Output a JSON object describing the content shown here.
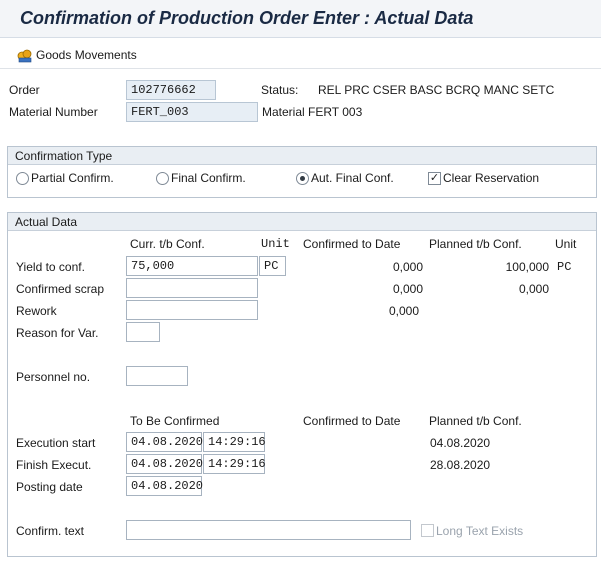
{
  "title": "Confirmation of Production Order Enter : Actual Data",
  "toolbar": {
    "goods_movements": "Goods Movements",
    "goods_icon": "goods-movements-icon"
  },
  "header": {
    "order_label": "Order",
    "order_value": "102776662",
    "status_label": "Status:",
    "status_value": "REL  PRC  CSER BASC BCRQ MANC SETC",
    "material_label": "Material Number",
    "material_value": "FERT_003",
    "material_desc": "Material FERT 003"
  },
  "confirmation_type": {
    "title": "Confirmation Type",
    "partial": "Partial Confirm.",
    "final": "Final Confirm.",
    "auto_final": "Aut. Final Conf.",
    "clear_reservation": "Clear Reservation",
    "selected": "auto_final",
    "clear_reservation_checked": true
  },
  "actual_data": {
    "title": "Actual Data",
    "col_curr": "Curr. t/b Conf.",
    "col_unit": "Unit",
    "col_confirmed": "Confirmed to Date",
    "col_planned": "Planned t/b Conf.",
    "col_unit2": "Unit",
    "yield_label": "Yield to conf.",
    "yield_value": "75,000",
    "yield_unit": "PC",
    "yield_confirmed": "0,000",
    "yield_planned": "100,000",
    "yield_planned_unit": "PC",
    "scrap_label": "Confirmed scrap",
    "scrap_value": "",
    "scrap_confirmed": "0,000",
    "scrap_planned": "0,000",
    "rework_label": "Rework",
    "rework_value": "",
    "rework_confirmed": "0,000",
    "reason_label": "Reason for Var.",
    "reason_value": "",
    "personnel_label": "Personnel no.",
    "personnel_value": "",
    "col_to_be": "To Be Confirmed",
    "col_confirmed2": "Confirmed to Date",
    "col_planned2": "Planned t/b Conf.",
    "exec_start_label": "Execution start",
    "exec_start_date": "04.08.2020",
    "exec_start_time": "14:29:16",
    "exec_start_planned": "04.08.2020",
    "finish_label": "Finish Execut.",
    "finish_date": "04.08.2020",
    "finish_time": "14:29:16",
    "finish_planned": "28.08.2020",
    "posting_label": "Posting date",
    "posting_date": "04.08.2020",
    "confirm_text_label": "Confirm. text",
    "confirm_text_value": "",
    "long_text_label": "Long Text Exists"
  }
}
